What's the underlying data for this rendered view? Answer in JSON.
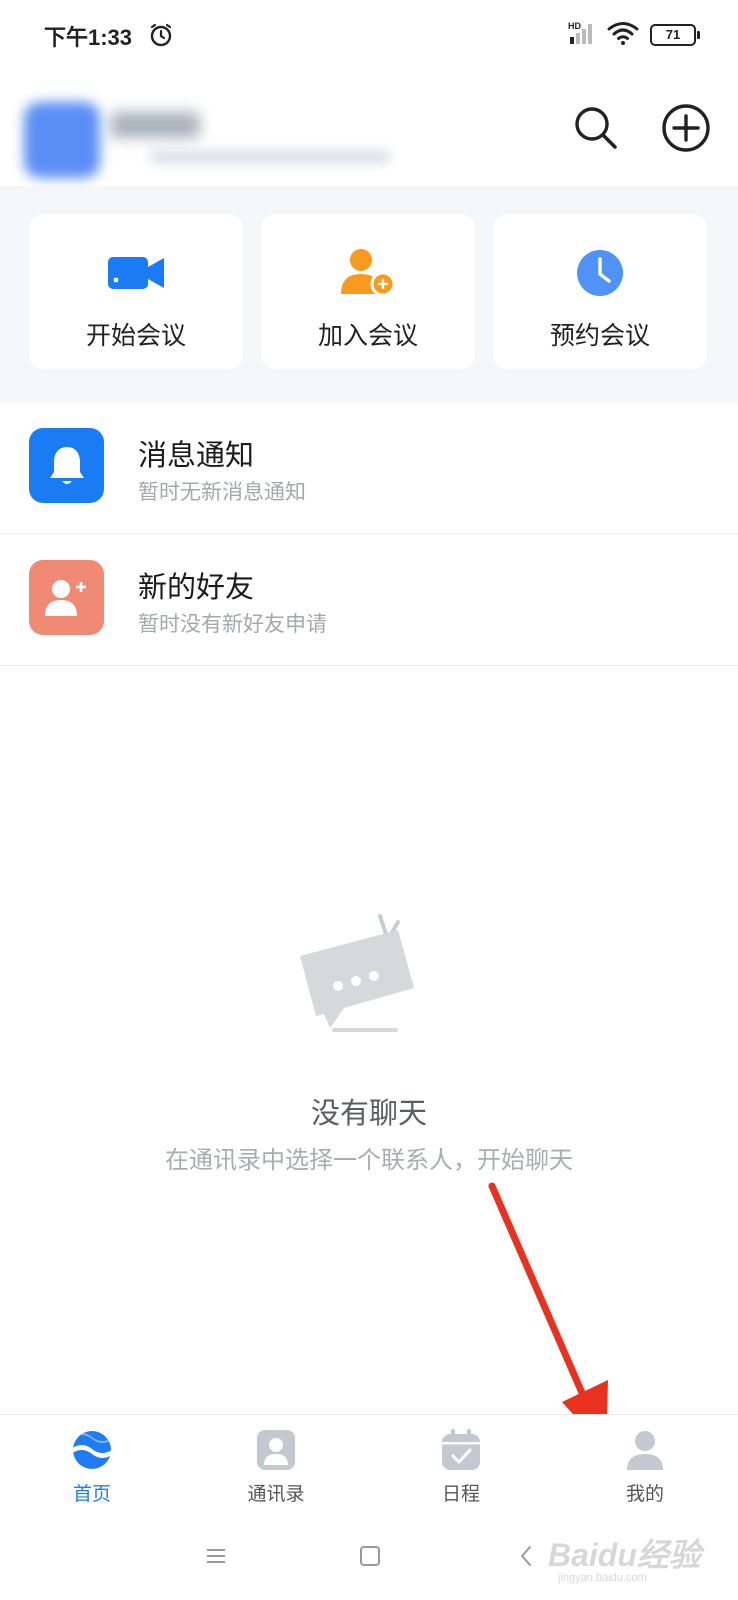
{
  "status_bar": {
    "time": "下午1:33",
    "network": "HD",
    "battery": "71"
  },
  "header": {
    "search_icon": "search-icon",
    "add_icon": "plus-circle-icon"
  },
  "quick_actions": [
    {
      "label": "开始会议",
      "icon": "video-camera-icon",
      "color": "#1a7cf5"
    },
    {
      "label": "加入会议",
      "icon": "add-person-icon",
      "color": "#f79a1d"
    },
    {
      "label": "预约会议",
      "icon": "clock-icon",
      "color": "#4f93f7"
    }
  ],
  "list": {
    "notice": {
      "title": "消息通知",
      "subtitle": "暂时无新消息通知",
      "icon": "bell-icon",
      "color": "#1a7cf5"
    },
    "friend": {
      "title": "新的好友",
      "subtitle": "暂时没有新好友申请",
      "icon": "add-friend-icon",
      "color": "#f08a74"
    }
  },
  "empty_state": {
    "title": "没有聊天",
    "subtitle": "在通讯录中选择一个联系人，开始聊天"
  },
  "bottom_nav": {
    "items": [
      {
        "label": "首页",
        "icon": "home-logo-icon",
        "active": true
      },
      {
        "label": "通讯录",
        "icon": "contacts-icon",
        "active": false
      },
      {
        "label": "日程",
        "icon": "calendar-icon",
        "active": false
      },
      {
        "label": "我的",
        "icon": "profile-icon",
        "active": false
      }
    ]
  },
  "watermark": {
    "text": "Baidu经验",
    "url": "jingyan.baidu.com"
  },
  "colors": {
    "accent": "#1f7cf3",
    "arrow": "#e8321f"
  }
}
